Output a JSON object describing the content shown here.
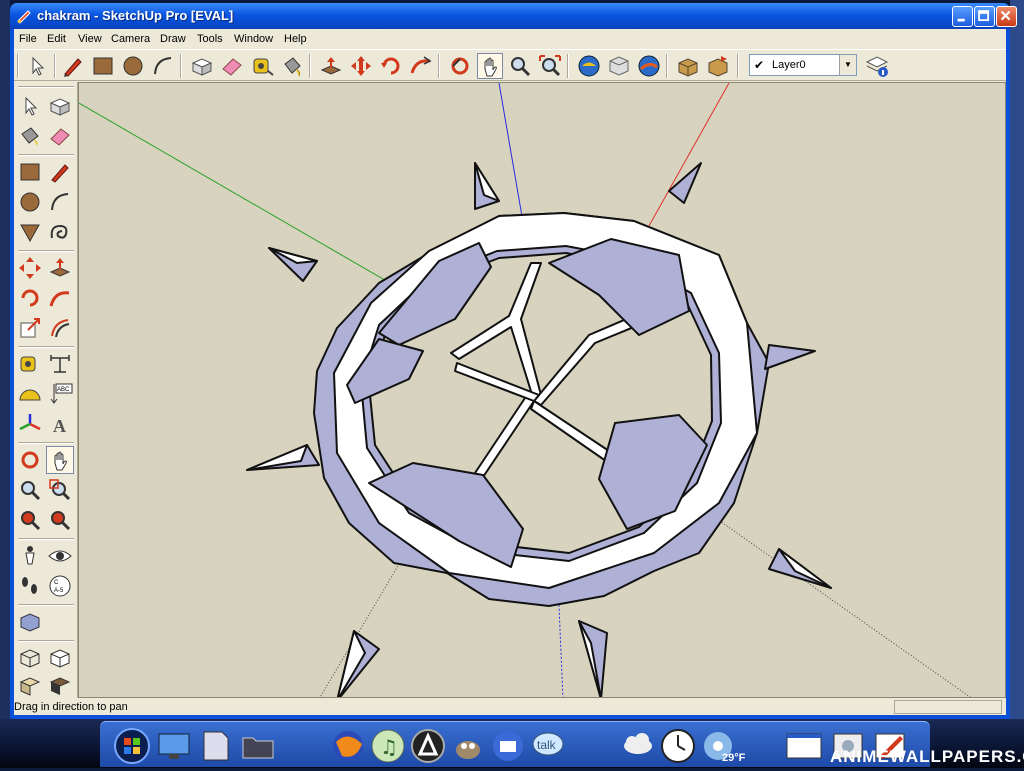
{
  "window": {
    "title": "chakram - SketchUp Pro [EVAL]"
  },
  "menu": [
    "File",
    "Edit",
    "View",
    "Camera",
    "Draw",
    "Tools",
    "Window",
    "Help"
  ],
  "toolbar": {
    "tools": [
      "select-icon",
      "pencil-icon",
      "rectangle-icon",
      "circle-icon",
      "arc-icon",
      "make-component-icon",
      "eraser-icon",
      "tape-measure-icon",
      "paint-bucket-icon",
      "push-pull-icon",
      "move-icon",
      "rotate-icon",
      "follow-me-icon",
      "orbit-icon",
      "pan-icon",
      "zoom-icon",
      "zoom-extents-icon",
      "get-models-icon",
      "share-model-icon",
      "google-earth-icon",
      "get-components-icon",
      "share-component-icon",
      "layer-manager-icon"
    ],
    "active_tool": "pan-icon",
    "layer_value": "Layer0"
  },
  "status": {
    "text": "Drag in direction to pan"
  },
  "taskbar": {
    "temperature": "29°F",
    "watermark": "ANIMEWALLPAPERS.COM"
  },
  "colors": {
    "viewport_bg": "#d7d3bf",
    "face_front": "#ffffff",
    "face_side": "#aeb0d6",
    "axis_red": "#e0302a",
    "axis_green": "#28a028",
    "axis_blue": "#2a2ae0"
  }
}
